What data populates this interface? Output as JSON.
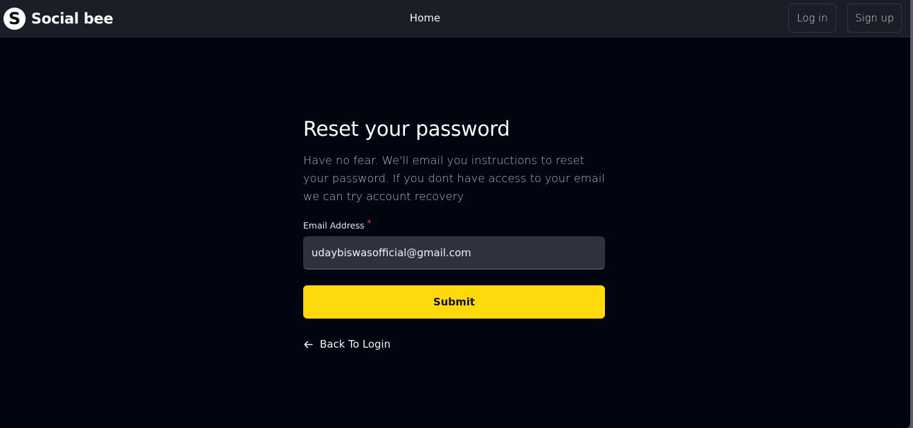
{
  "navbar": {
    "brand_letter": "S",
    "brand_name": "Social bee",
    "home_label": "Home",
    "login_label": "Log in",
    "signup_label": "Sign up"
  },
  "form": {
    "title": "Reset your password",
    "description": "Have no fear. We'll email you instructions to reset your password. If you dont have access to your email we can try account recovery",
    "email_label": "Email Address",
    "required_marker": "*",
    "email_value": "udaybiswasofficial@gmail.com",
    "submit_label": "Submit",
    "back_label": "Back To Login"
  },
  "colors": {
    "background": "#000510",
    "navbar": "#1a1e27",
    "accent": "#fed90b",
    "input_bg": "#2e323c"
  },
  "icons": {
    "brand": "social-bee-logo-icon",
    "back": "arrow-left-icon"
  }
}
